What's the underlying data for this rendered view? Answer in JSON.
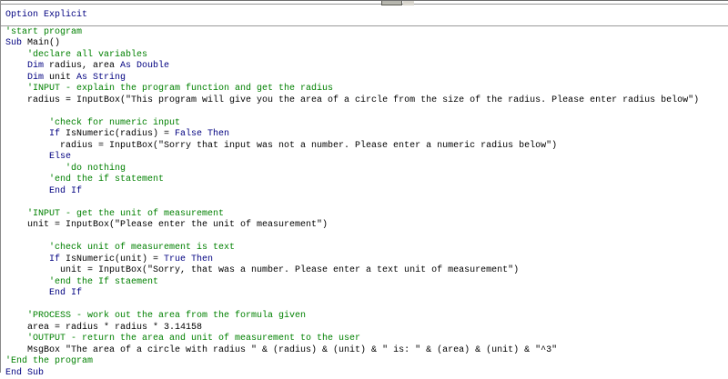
{
  "editor": {
    "type": "vba-code-window",
    "colors": {
      "keyword": "#000080",
      "comment": "#008000",
      "text": "#000000",
      "separator": "#9a9a9a"
    },
    "code": {
      "lines": [
        {
          "indent": 0,
          "sep_after": true,
          "tokens": [
            {
              "t": "kw",
              "v": "Option Explicit"
            }
          ]
        },
        {
          "indent": 0,
          "tokens": [
            {
              "t": "cm",
              "v": "'start program"
            }
          ]
        },
        {
          "indent": 0,
          "tokens": [
            {
              "t": "kw",
              "v": "Sub "
            },
            {
              "t": "tx",
              "v": "Main()"
            }
          ]
        },
        {
          "indent": 4,
          "tokens": [
            {
              "t": "cm",
              "v": "'declare all variables"
            }
          ]
        },
        {
          "indent": 4,
          "tokens": [
            {
              "t": "kw",
              "v": "Dim "
            },
            {
              "t": "tx",
              "v": "radius, area "
            },
            {
              "t": "kw",
              "v": "As Double"
            }
          ]
        },
        {
          "indent": 4,
          "tokens": [
            {
              "t": "kw",
              "v": "Dim "
            },
            {
              "t": "tx",
              "v": "unit "
            },
            {
              "t": "kw",
              "v": "As String"
            }
          ]
        },
        {
          "indent": 4,
          "tokens": [
            {
              "t": "cm",
              "v": "'INPUT - explain the program function and get the radius"
            }
          ]
        },
        {
          "indent": 4,
          "tokens": [
            {
              "t": "tx",
              "v": "radius = InputBox(\"This program will give you the area of a circle from the size of the radius. Please enter radius below\")"
            }
          ]
        },
        {
          "indent": 0,
          "tokens": []
        },
        {
          "indent": 8,
          "tokens": [
            {
              "t": "cm",
              "v": "'check for numeric input"
            }
          ]
        },
        {
          "indent": 8,
          "tokens": [
            {
              "t": "kw",
              "v": "If "
            },
            {
              "t": "tx",
              "v": "IsNumeric(radius) = "
            },
            {
              "t": "kw",
              "v": "False Then"
            }
          ]
        },
        {
          "indent": 10,
          "tokens": [
            {
              "t": "tx",
              "v": "radius = InputBox(\"Sorry that input was not a number. Please enter a numeric radius below\")"
            }
          ]
        },
        {
          "indent": 8,
          "tokens": [
            {
              "t": "kw",
              "v": "Else"
            }
          ]
        },
        {
          "indent": 11,
          "tokens": [
            {
              "t": "cm",
              "v": "'do nothing"
            }
          ]
        },
        {
          "indent": 8,
          "tokens": [
            {
              "t": "cm",
              "v": "'end the if statement"
            }
          ]
        },
        {
          "indent": 8,
          "tokens": [
            {
              "t": "kw",
              "v": "End If"
            }
          ]
        },
        {
          "indent": 0,
          "tokens": []
        },
        {
          "indent": 4,
          "tokens": [
            {
              "t": "cm",
              "v": "'INPUT - get the unit of measurement"
            }
          ]
        },
        {
          "indent": 4,
          "tokens": [
            {
              "t": "tx",
              "v": "unit = InputBox(\"Please enter the unit of measurement\")"
            }
          ]
        },
        {
          "indent": 0,
          "tokens": []
        },
        {
          "indent": 8,
          "tokens": [
            {
              "t": "cm",
              "v": "'check unit of measurement is text"
            }
          ]
        },
        {
          "indent": 8,
          "tokens": [
            {
              "t": "kw",
              "v": "If "
            },
            {
              "t": "tx",
              "v": "IsNumeric(unit) = "
            },
            {
              "t": "kw",
              "v": "True Then"
            }
          ]
        },
        {
          "indent": 10,
          "tokens": [
            {
              "t": "tx",
              "v": "unit = InputBox(\"Sorry, that was a number. Please enter a text unit of measurement\")"
            }
          ]
        },
        {
          "indent": 8,
          "tokens": [
            {
              "t": "cm",
              "v": "'end the If staement"
            }
          ]
        },
        {
          "indent": 8,
          "tokens": [
            {
              "t": "kw",
              "v": "End If"
            }
          ]
        },
        {
          "indent": 0,
          "tokens": []
        },
        {
          "indent": 4,
          "tokens": [
            {
              "t": "cm",
              "v": "'PROCESS - work out the area from the formula given"
            }
          ]
        },
        {
          "indent": 4,
          "tokens": [
            {
              "t": "tx",
              "v": "area = radius * radius * 3.14158"
            }
          ]
        },
        {
          "indent": 4,
          "tokens": [
            {
              "t": "cm",
              "v": "'OUTPUT - return the area and unit of measurement to the user"
            }
          ]
        },
        {
          "indent": 4,
          "tokens": [
            {
              "t": "tx",
              "v": "MsgBox \"The area of a circle with radius \" & (radius) & (unit) & \" is: \" & (area) & (unit) & \"^3\""
            }
          ]
        },
        {
          "indent": 0,
          "tokens": [
            {
              "t": "cm",
              "v": "'End the program"
            }
          ]
        },
        {
          "indent": 0,
          "tokens": [
            {
              "t": "kw",
              "v": "End Sub"
            }
          ]
        }
      ]
    }
  }
}
